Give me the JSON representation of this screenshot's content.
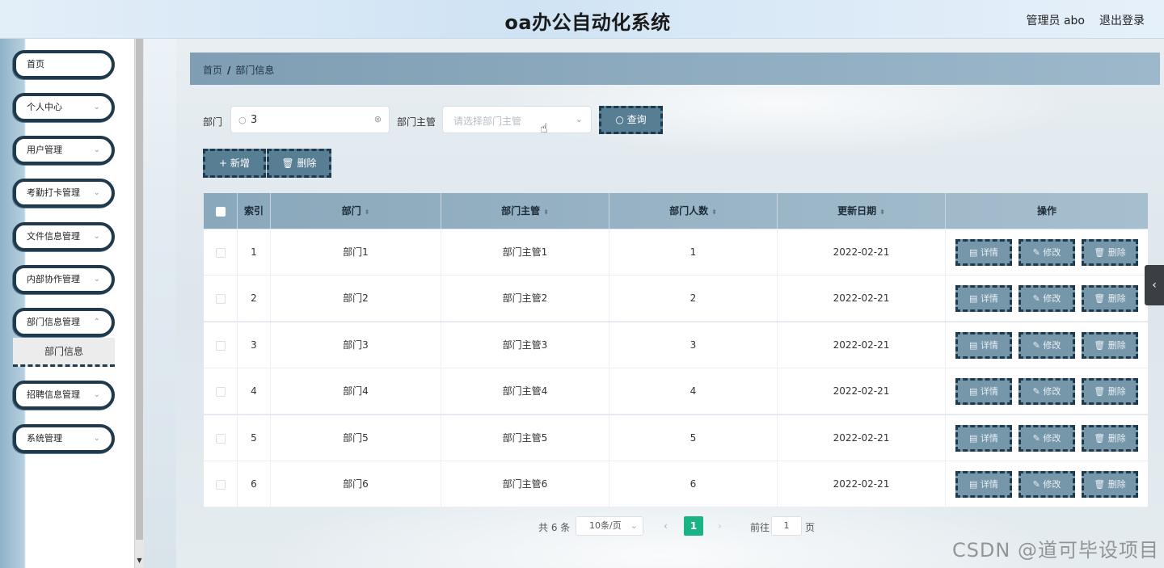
{
  "header": {
    "title": "oa办公自动化系统",
    "user": "管理员 abo",
    "logout": "退出登录"
  },
  "sidebar": {
    "items": [
      {
        "label": "首页",
        "has_chevron": false
      },
      {
        "label": "个人中心",
        "has_chevron": true
      },
      {
        "label": "用户管理",
        "has_chevron": true
      },
      {
        "label": "考勤打卡管理",
        "has_chevron": true
      },
      {
        "label": "文件信息管理",
        "has_chevron": true
      },
      {
        "label": "内部协作管理",
        "has_chevron": true
      },
      {
        "label": "部门信息管理",
        "has_chevron": true
      },
      {
        "label": "招聘信息管理",
        "has_chevron": true
      },
      {
        "label": "系统管理",
        "has_chevron": true
      }
    ],
    "submenu_active": "部门信息"
  },
  "breadcrumb": {
    "home": "首页",
    "separator": "/",
    "current": "部门信息"
  },
  "search": {
    "dept_label": "部门",
    "dept_value": "3",
    "manager_label": "部门主管",
    "manager_placeholder": "请选择部门主管",
    "query_button": "查询"
  },
  "actions": {
    "add": "新增",
    "delete": "删除"
  },
  "table": {
    "columns": [
      "索引",
      "部门",
      "部门主管",
      "部门人数",
      "更新日期",
      "操作"
    ],
    "rows": [
      {
        "index": "1",
        "dept": "部门1",
        "manager": "部门主管1",
        "count": "1",
        "date": "2022-02-21"
      },
      {
        "index": "2",
        "dept": "部门2",
        "manager": "部门主管2",
        "count": "2",
        "date": "2022-02-21"
      },
      {
        "index": "3",
        "dept": "部门3",
        "manager": "部门主管3",
        "count": "3",
        "date": "2022-02-21"
      },
      {
        "index": "4",
        "dept": "部门4",
        "manager": "部门主管4",
        "count": "4",
        "date": "2022-02-21"
      },
      {
        "index": "5",
        "dept": "部门5",
        "manager": "部门主管5",
        "count": "5",
        "date": "2022-02-21"
      },
      {
        "index": "6",
        "dept": "部门6",
        "manager": "部门主管6",
        "count": "6",
        "date": "2022-02-21"
      }
    ],
    "row_actions": {
      "detail": "详情",
      "edit": "修改",
      "delete": "删除"
    }
  },
  "pagination": {
    "total": "共 6 条",
    "page_size": "10条/页",
    "current_page": "1",
    "goto_label": "前往",
    "goto_value": "1",
    "page_suffix": "页"
  },
  "watermark": "CSDN @道可毕设项目",
  "colors": {
    "accent_dark": "#1f3a4d",
    "button_fill": "#587e93",
    "page_active": "#19b386"
  }
}
